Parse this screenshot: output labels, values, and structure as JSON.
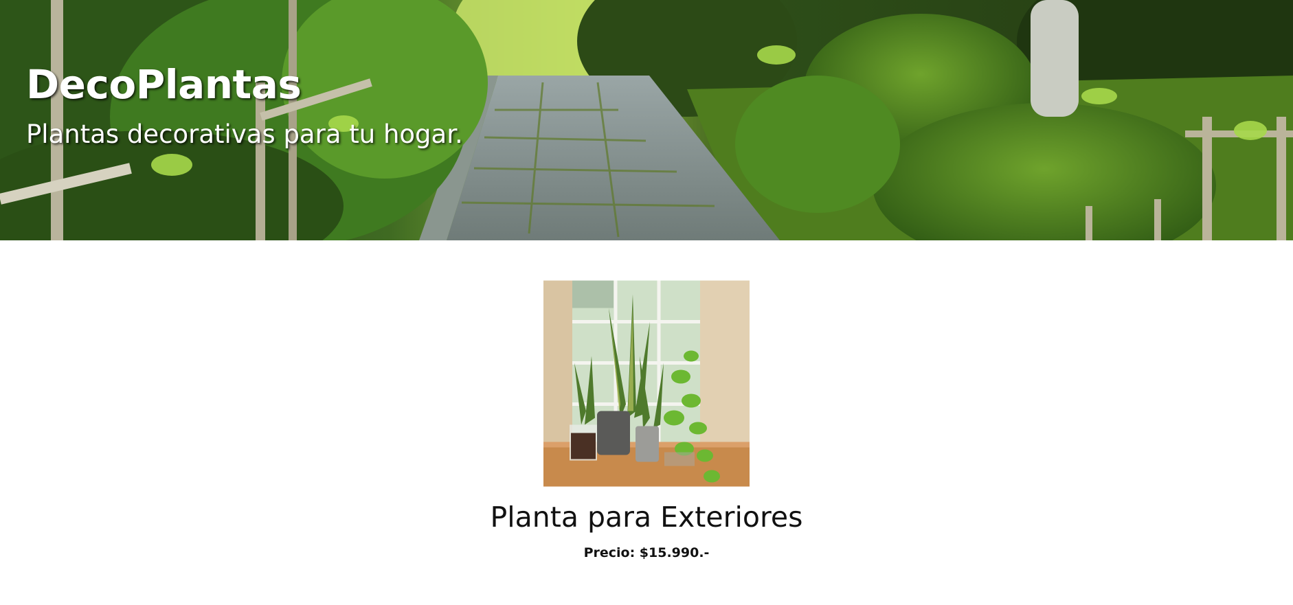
{
  "site": {
    "title": "DecoPlantas",
    "subtitle": "Plantas decorativas para tu hogar."
  },
  "hero": {
    "image": "garden-path-image"
  },
  "product": {
    "image": "potted-plants-by-window-image",
    "name": "Planta para Exteriores",
    "price": "Precio: $15.990.-"
  },
  "colors": {
    "hero_text": "#ffffff",
    "body_text": "#111111",
    "background": "#ffffff",
    "foliage_dark": "#1f3a12",
    "foliage_light": "#8fcf3f",
    "stone_path": "#7d8a8c"
  }
}
